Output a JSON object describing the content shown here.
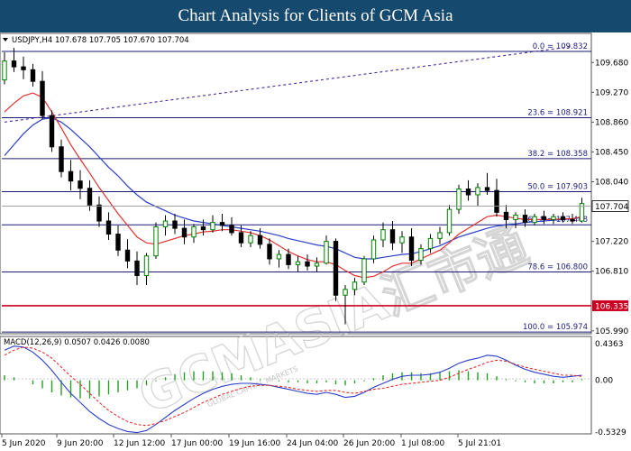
{
  "banner": {
    "title": "Chart Analysis for Clients of GCM Asia"
  },
  "watermark": {
    "main": "GCMASIA汇市通",
    "sub": "GLOBAL CAPITAL MARKETS"
  },
  "colors": {
    "banner": "#16496e",
    "bull": "#008000",
    "bear": "#cc0000",
    "wick": "#000000",
    "ma_fast": "#e03030",
    "ma_slow": "#2a3ec8",
    "fib": "#1a1a7a",
    "support": "#cc0022",
    "trend": "#4a2a9a",
    "macd_line": "#2a3ec8",
    "signal_line": "#e03030",
    "histogram": "#22a022"
  },
  "chart_data": [
    {
      "type": "candlestick",
      "header": "USDJPY,H4  107.678 107.705 107.670 107.704",
      "symbol": "USDJPY",
      "timeframe": "H4",
      "ohlc_last": {
        "open": 107.678,
        "high": 107.705,
        "low": 107.67,
        "close": 107.704
      },
      "ylim": [
        105.95,
        110.08
      ],
      "y_ticks": [
        "109.680",
        "109.270",
        "108.860",
        "108.450",
        "108.040",
        "107.630",
        "107.220",
        "106.810",
        "105.990"
      ],
      "x_ticks": [
        "5 Jun 2020",
        "9 Jun 20:00",
        "12 Jun 12:00",
        "17 Jun 00:00",
        "19 Jun 16:00",
        "24 Jun 04:00",
        "26 Jun 20:00",
        "1 Jul 08:00",
        "5 Jul 21:01"
      ],
      "current_price": "107.704",
      "fibonacci_levels": [
        {
          "ratio": "0.0",
          "value": 109.832,
          "label": "0.0 = 109.832"
        },
        {
          "ratio": "23.6",
          "value": 108.921,
          "label": "23.6 = 108.921"
        },
        {
          "ratio": "38.2",
          "value": 108.358,
          "label": "38.2 = 108.358"
        },
        {
          "ratio": "50.0",
          "value": 107.903,
          "label": "50.0 = 107.903"
        },
        {
          "ratio": "61.8",
          "value": 107.448,
          "label": "61.8 = 107.448"
        },
        {
          "ratio": "78.6",
          "value": 106.8,
          "label": "78.6 = 106.800"
        },
        {
          "ratio": "100.0",
          "value": 105.974,
          "label": "100.0 = 105.974"
        }
      ],
      "support_level": {
        "value": 106.335,
        "label": "106.335"
      },
      "trendline": {
        "from": {
          "bar": 0,
          "price": 108.86
        },
        "to": {
          "bar": 60,
          "price": 109.9
        }
      },
      "candles": [
        [
          109.44,
          109.82,
          109.38,
          109.7
        ],
        [
          109.7,
          109.88,
          109.55,
          109.62
        ],
        [
          109.62,
          109.76,
          109.45,
          109.58
        ],
        [
          109.58,
          109.66,
          109.35,
          109.42
        ],
        [
          109.42,
          109.56,
          108.9,
          108.95
        ],
        [
          108.95,
          109.02,
          108.45,
          108.52
        ],
        [
          108.52,
          108.62,
          108.1,
          108.18
        ],
        [
          108.18,
          108.34,
          107.92,
          108.05
        ],
        [
          108.05,
          108.2,
          107.8,
          107.95
        ],
        [
          107.95,
          108.06,
          107.64,
          107.72
        ],
        [
          107.72,
          107.84,
          107.42,
          107.5
        ],
        [
          107.5,
          107.62,
          107.24,
          107.32
        ],
        [
          107.32,
          107.44,
          107.02,
          107.1
        ],
        [
          107.1,
          107.25,
          106.85,
          106.95
        ],
        [
          106.95,
          107.08,
          106.62,
          106.75
        ],
        [
          106.75,
          107.06,
          106.62,
          107.02
        ],
        [
          107.02,
          107.48,
          106.98,
          107.42
        ],
        [
          107.42,
          107.58,
          107.3,
          107.5
        ],
        [
          107.5,
          107.6,
          107.32,
          107.4
        ],
        [
          107.4,
          107.52,
          107.18,
          107.28
        ],
        [
          107.28,
          107.46,
          107.2,
          107.42
        ],
        [
          107.42,
          107.52,
          107.3,
          107.38
        ],
        [
          107.38,
          107.58,
          107.34,
          107.48
        ],
        [
          107.48,
          107.6,
          107.36,
          107.44
        ],
        [
          107.44,
          107.55,
          107.3,
          107.34
        ],
        [
          107.34,
          107.44,
          107.14,
          107.2
        ],
        [
          107.2,
          107.36,
          107.14,
          107.3
        ],
        [
          107.3,
          107.4,
          107.12,
          107.18
        ],
        [
          107.18,
          107.26,
          106.9,
          106.98
        ],
        [
          106.98,
          107.1,
          106.86,
          107.04
        ],
        [
          107.04,
          107.12,
          106.84,
          106.9
        ],
        [
          106.9,
          107.02,
          106.8,
          106.94
        ],
        [
          106.94,
          107.04,
          106.82,
          106.88
        ],
        [
          106.88,
          107.0,
          106.8,
          106.92
        ],
        [
          106.92,
          107.3,
          106.9,
          107.22
        ],
        [
          107.22,
          107.26,
          106.4,
          106.48
        ],
        [
          106.48,
          106.62,
          106.08,
          106.56
        ],
        [
          106.56,
          106.72,
          106.48,
          106.66
        ],
        [
          106.66,
          107.02,
          106.62,
          106.98
        ],
        [
          106.98,
          107.3,
          106.92,
          107.24
        ],
        [
          107.24,
          107.48,
          107.14,
          107.38
        ],
        [
          107.38,
          107.5,
          107.1,
          107.2
        ],
        [
          107.2,
          107.36,
          107.06,
          107.28
        ],
        [
          107.28,
          107.4,
          106.88,
          106.96
        ],
        [
          106.96,
          107.18,
          106.9,
          107.12
        ],
        [
          107.12,
          107.32,
          107.06,
          107.26
        ],
        [
          107.26,
          107.42,
          107.18,
          107.34
        ],
        [
          107.34,
          107.72,
          107.3,
          107.66
        ],
        [
          107.66,
          108.0,
          107.6,
          107.94
        ],
        [
          107.94,
          108.06,
          107.78,
          107.86
        ],
        [
          107.86,
          108.02,
          107.7,
          107.96
        ],
        [
          107.96,
          108.16,
          107.86,
          107.92
        ],
        [
          107.92,
          108.08,
          107.56,
          107.62
        ],
        [
          107.62,
          107.72,
          107.4,
          107.52
        ],
        [
          107.52,
          107.62,
          107.4,
          107.58
        ],
        [
          107.58,
          107.66,
          107.42,
          107.48
        ],
        [
          107.48,
          107.6,
          107.44,
          107.56
        ],
        [
          107.56,
          107.64,
          107.46,
          107.52
        ],
        [
          107.52,
          107.6,
          107.46,
          107.56
        ],
        [
          107.56,
          107.62,
          107.48,
          107.52
        ],
        [
          107.52,
          107.6,
          107.46,
          107.5
        ],
        [
          107.5,
          107.82,
          107.48,
          107.74
        ]
      ],
      "ma_fast": [
        109.0,
        109.12,
        109.22,
        109.26,
        109.2,
        109.0,
        108.78,
        108.55,
        108.35,
        108.16,
        107.96,
        107.78,
        107.6,
        107.44,
        107.28,
        107.2,
        107.18,
        107.22,
        107.26,
        107.3,
        107.32,
        107.35,
        107.36,
        107.38,
        107.38,
        107.36,
        107.34,
        107.3,
        107.24,
        107.16,
        107.08,
        107.02,
        106.97,
        106.94,
        106.94,
        106.9,
        106.82,
        106.75,
        106.72,
        106.74,
        106.8,
        106.88,
        106.92,
        106.92,
        106.98,
        107.04,
        107.1,
        107.2,
        107.32,
        107.4,
        107.48,
        107.56,
        107.58,
        107.56,
        107.54,
        107.52,
        107.52,
        107.52,
        107.52,
        107.53,
        107.53,
        107.56
      ],
      "ma_slow": [
        108.4,
        108.55,
        108.7,
        108.82,
        108.9,
        108.92,
        108.86,
        108.76,
        108.64,
        108.52,
        108.38,
        108.24,
        108.12,
        107.98,
        107.86,
        107.76,
        107.7,
        107.64,
        107.58,
        107.54,
        107.5,
        107.48,
        107.46,
        107.44,
        107.42,
        107.4,
        107.38,
        107.36,
        107.33,
        107.3,
        107.26,
        107.23,
        107.2,
        107.17,
        107.15,
        107.12,
        107.06,
        107.0,
        106.98,
        106.98,
        107.0,
        107.02,
        107.04,
        107.05,
        107.08,
        107.12,
        107.16,
        107.22,
        107.28,
        107.32,
        107.36,
        107.4,
        107.43,
        107.45,
        107.46,
        107.48,
        107.49,
        107.5,
        107.51,
        107.52,
        107.53,
        107.55
      ]
    },
    {
      "type": "macd",
      "header": "MACD(12,26,9) 0.0507 0.0426 0.0080",
      "params": "12,26,9",
      "values": {
        "macd": 0.0507,
        "signal": 0.0426,
        "histogram": 0.008
      },
      "ylim": [
        -0.5329,
        0.4363
      ],
      "y_ticks": [
        "0.4363",
        "0.00",
        "-0.5329"
      ],
      "histogram": [
        0.05,
        0.03,
        0.0,
        -0.04,
        -0.08,
        -0.12,
        -0.15,
        -0.17,
        -0.18,
        -0.18,
        -0.16,
        -0.14,
        -0.12,
        -0.1,
        -0.08,
        -0.05,
        -0.01,
        0.03,
        0.06,
        0.08,
        0.09,
        0.09,
        0.09,
        0.08,
        0.07,
        0.05,
        0.03,
        0.01,
        0.0,
        -0.01,
        -0.02,
        -0.02,
        -0.03,
        -0.03,
        -0.02,
        -0.04,
        -0.05,
        -0.03,
        -0.01,
        0.02,
        0.05,
        0.07,
        0.08,
        0.08,
        0.07,
        0.07,
        0.08,
        0.09,
        0.1,
        0.09,
        0.08,
        0.07,
        0.04,
        0.01,
        -0.01,
        -0.02,
        -0.03,
        -0.03,
        -0.03,
        -0.02,
        -0.02,
        0.01
      ],
      "macd": [
        0.3,
        0.34,
        0.33,
        0.28,
        0.2,
        0.1,
        -0.02,
        -0.13,
        -0.22,
        -0.31,
        -0.38,
        -0.44,
        -0.48,
        -0.51,
        -0.52,
        -0.5,
        -0.44,
        -0.37,
        -0.3,
        -0.24,
        -0.18,
        -0.13,
        -0.09,
        -0.06,
        -0.04,
        -0.03,
        -0.03,
        -0.04,
        -0.05,
        -0.07,
        -0.09,
        -0.11,
        -0.13,
        -0.14,
        -0.12,
        -0.14,
        -0.17,
        -0.16,
        -0.12,
        -0.07,
        -0.03,
        0.01,
        0.04,
        0.05,
        0.05,
        0.06,
        0.08,
        0.12,
        0.17,
        0.2,
        0.22,
        0.25,
        0.24,
        0.2,
        0.15,
        0.11,
        0.08,
        0.06,
        0.04,
        0.03,
        0.04,
        0.05
      ],
      "signal": [
        0.25,
        0.3,
        0.33,
        0.32,
        0.28,
        0.22,
        0.13,
        0.04,
        -0.04,
        -0.13,
        -0.22,
        -0.3,
        -0.36,
        -0.41,
        -0.44,
        -0.45,
        -0.43,
        -0.4,
        -0.36,
        -0.32,
        -0.27,
        -0.22,
        -0.18,
        -0.14,
        -0.11,
        -0.08,
        -0.06,
        -0.05,
        -0.05,
        -0.06,
        -0.07,
        -0.09,
        -0.1,
        -0.11,
        -0.1,
        -0.1,
        -0.12,
        -0.13,
        -0.11,
        -0.09,
        -0.08,
        -0.06,
        -0.04,
        -0.03,
        -0.02,
        -0.01,
        0.0,
        0.03,
        0.07,
        0.11,
        0.14,
        0.18,
        0.2,
        0.19,
        0.16,
        0.13,
        0.11,
        0.09,
        0.07,
        0.05,
        0.05,
        0.04
      ]
    }
  ]
}
